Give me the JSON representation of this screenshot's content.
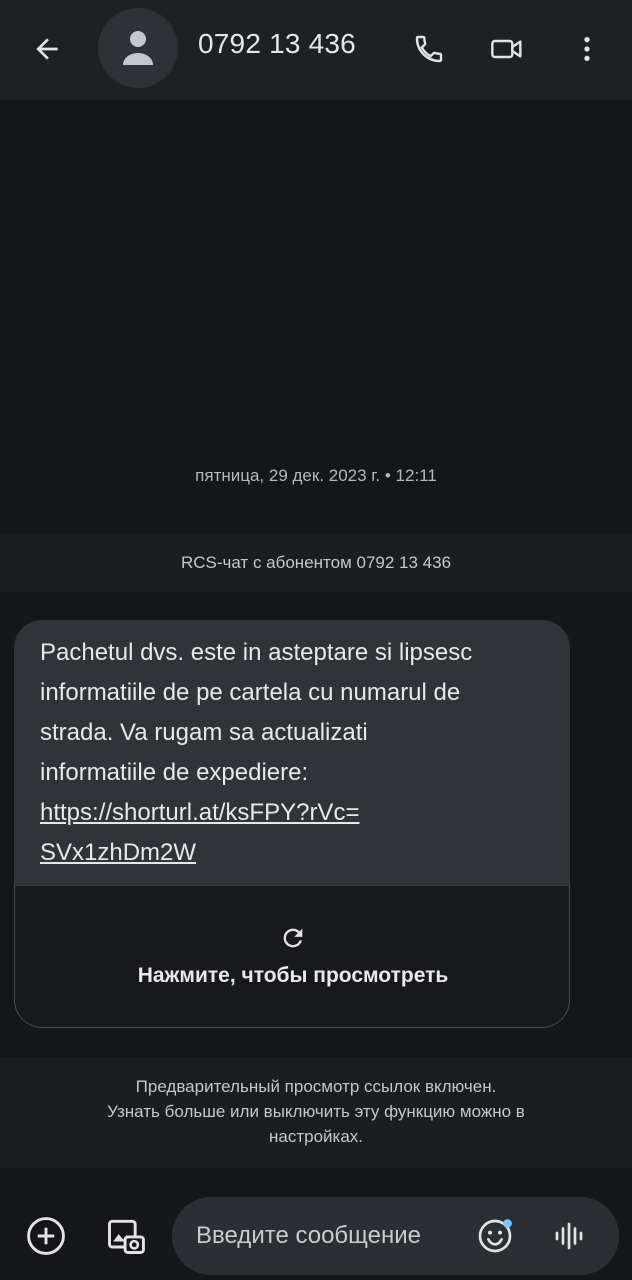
{
  "header": {
    "title": "0792 13 436",
    "icons": {
      "back": "arrow-back-icon",
      "avatar": "person-icon",
      "call": "phone-icon",
      "video": "video-camera-icon",
      "more": "more-vert-icon"
    }
  },
  "conversation": {
    "date_time": "пятница, 29 дек. 2023 г. • 12:11",
    "rcs_notice": "RCS-чат с абонентом 0792 13 436",
    "message": {
      "lines": [
        "Pachetul dvs. este in asteptare si lipsesc",
        "informatiile de pe cartela cu numarul de",
        "strada. Va rugam sa actualizati",
        "informatiile de expediere:"
      ],
      "link_lines": [
        "https://shorturl.at/ksFPY?rVc=",
        "SVx1zhDm2W"
      ],
      "preview_label": "Нажмите, чтобы просмотреть",
      "preview_icon": "refresh-icon"
    },
    "link_preview_notice": [
      "Предварительный просмотр ссылок включен.",
      "Узнать больше или выключить эту функцию можно в",
      "настройках."
    ]
  },
  "composer": {
    "placeholder": "Введите сообщение",
    "icons": {
      "add": "add-circle-icon",
      "gallery": "gallery-icon",
      "emoji": "emoji-icon",
      "voice": "voice-waveform-icon"
    }
  },
  "colors": {
    "background": "#141619",
    "appbar": "#1e2124",
    "bubble": "#303337",
    "emoji_dot": "#7cc4ff"
  }
}
